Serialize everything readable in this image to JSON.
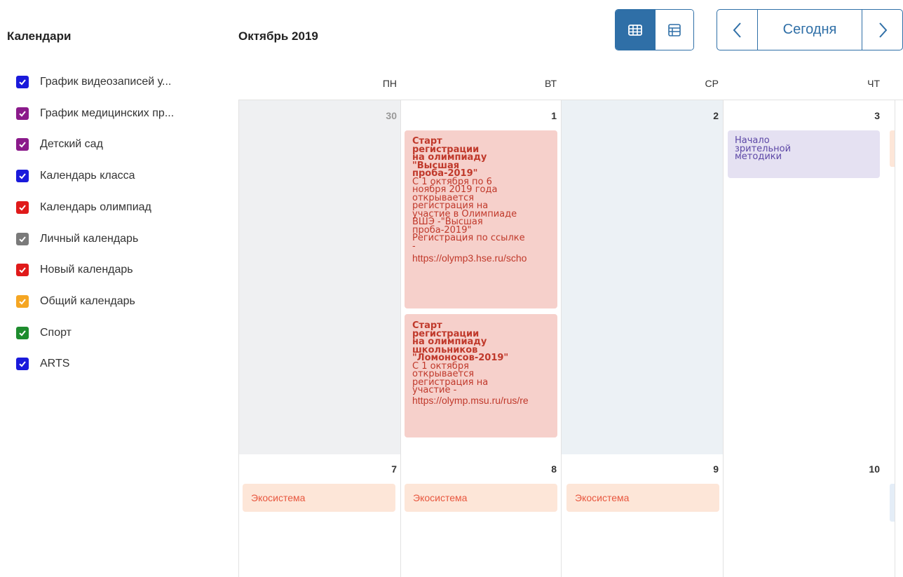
{
  "sidebar": {
    "title": "Календари",
    "calendars": [
      {
        "label": "График видеозаписей у...",
        "color": "#1a1adb"
      },
      {
        "label": "График медицинских пр...",
        "color": "#8b1a8b"
      },
      {
        "label": "Детский сад",
        "color": "#8b1a8b"
      },
      {
        "label": "Календарь класса",
        "color": "#1a1adb"
      },
      {
        "label": "Календарь олимпиад",
        "color": "#e01a1a"
      },
      {
        "label": "Личный календарь",
        "color": "#7a7a7a"
      },
      {
        "label": "Новый календарь",
        "color": "#e01a1a"
      },
      {
        "label": "Общий календарь",
        "color": "#f5a623"
      },
      {
        "label": "Спорт",
        "color": "#1e8c2e"
      },
      {
        "label": "ARTS",
        "color": "#1a1adb"
      }
    ]
  },
  "header": {
    "month": "Октябрь 2019",
    "view_month_icon": "grid-icon",
    "view_list_icon": "list-icon",
    "today_label": "Сегодня",
    "prev_icon": "chevron-left-icon",
    "next_icon": "chevron-right-icon",
    "accent_color": "#2f6fa7"
  },
  "weekdays": [
    "ПН",
    "ВТ",
    "СР",
    "ЧТ"
  ],
  "weeks": [
    {
      "days": [
        "30",
        "1",
        "2",
        "3"
      ]
    },
    {
      "days": [
        "7",
        "8",
        "9",
        "10"
      ]
    }
  ],
  "events": {
    "hse": {
      "title_lines": [
        "Старт",
        "регистрации",
        "на олимпиаду",
        "\"Высшая",
        "проба-2019\""
      ],
      "desc_lines": [
        "С 1 октября по 6",
        "ноября 2019 года",
        "открывается",
        "регистрация на",
        "участие в Олимпиаде",
        "ВШЭ -\"Высшая",
        "проба-2019\"",
        "Регистрация по ссылке",
        "-"
      ],
      "url": "https://olymp3.hse.ru/scho"
    },
    "msu": {
      "title_lines": [
        "Старт",
        "регистрации",
        "на олимпиаду",
        "школьников",
        "\"Ломоносов-2019\""
      ],
      "desc_lines": [
        "С 1 октября",
        "открывается",
        "регистрация на",
        "участие -"
      ],
      "url": "https://olymp.msu.ru/rus/re"
    },
    "vision": {
      "title_lines": [
        "Начало",
        "зрительной",
        "методики"
      ]
    },
    "eco": [
      "Экосистема",
      "Экосистема",
      "Экосистема"
    ]
  }
}
